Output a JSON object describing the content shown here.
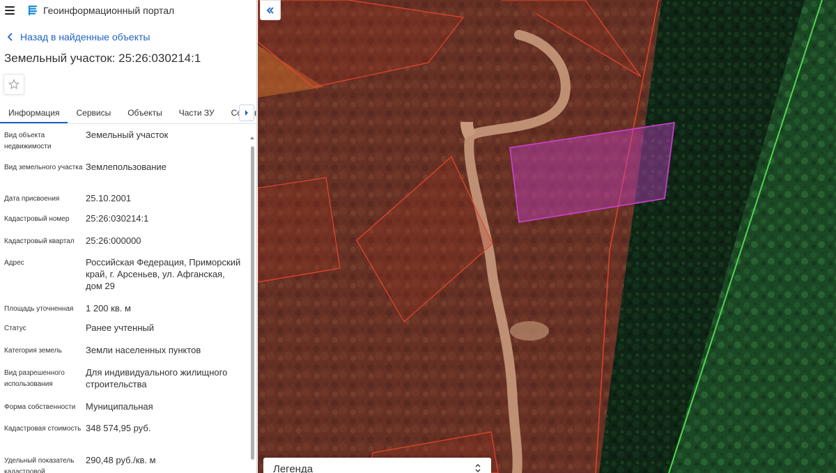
{
  "header": {
    "app_title": "Геоинформационный портал"
  },
  "back_link": "Назад в найденные объекты",
  "object_title": "Земельный участок: 25:26:030214:1",
  "tabs": [
    {
      "label": "Информация"
    },
    {
      "label": "Сервисы"
    },
    {
      "label": "Объекты"
    },
    {
      "label": "Части ЗУ"
    },
    {
      "label": "Состав"
    }
  ],
  "info": [
    {
      "label": "Вид объекта недвижимости",
      "value": "Земельный участок"
    },
    {
      "label": "Вид земельного участка",
      "value": "Землепользование"
    },
    {
      "label": "Дата присвоения",
      "value": "25.10.2001"
    },
    {
      "label": "Кадастровый номер",
      "value": "25:26:030214:1"
    },
    {
      "label": "Кадастровый квартал",
      "value": "25:26:000000"
    },
    {
      "label": "Адрес",
      "value": "Российская Федерация, Приморский край, г. Арсеньев, ул. Афганская, дом 29"
    },
    {
      "label": "Площадь уточненная",
      "value": "1 200 кв. м"
    },
    {
      "label": "Статус",
      "value": "Ранее учтенный"
    },
    {
      "label": "Категория земель",
      "value": "Земли населенных пунктов"
    },
    {
      "label": "Вид разрешенного использования",
      "value": "Для индивидуального жилищного строительства"
    },
    {
      "label": "Форма собственности",
      "value": "Муниципальная"
    },
    {
      "label": "Кадастровая стоимость",
      "value": "348 574,95 руб."
    },
    {
      "label": "Удельный показатель кадастровой",
      "value": "290,48 руб./кв. м"
    }
  ],
  "map": {
    "legend_title": "Легенда"
  },
  "colors": {
    "accent": "#1e63c4",
    "parcel_stroke": "#e8452c",
    "selected_parcel": "#d040d0",
    "boundary_green": "#4fd64f"
  }
}
